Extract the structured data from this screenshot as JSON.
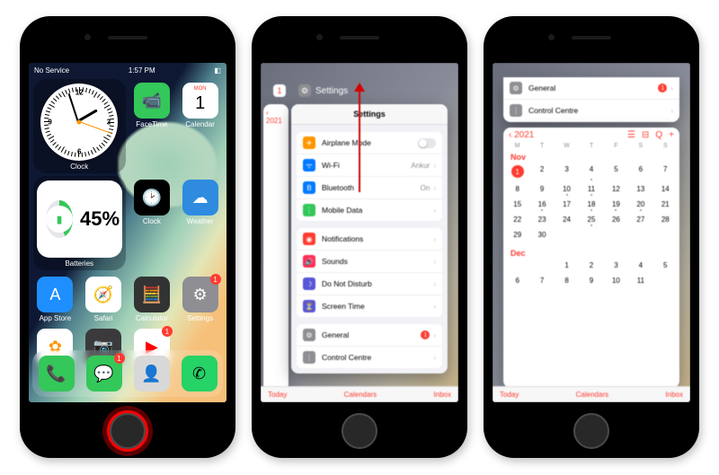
{
  "status": {
    "left": "No Service",
    "time": "1:57 PM",
    "battPct": "45"
  },
  "phone1": {
    "clockWidget": {
      "label": "Clock",
      "hourDeg": 60,
      "minDeg": 342,
      "secDeg": 110
    },
    "batteryWidget": {
      "label": "Batteries",
      "pct": "45%"
    },
    "row1": [
      {
        "name": "FaceTime",
        "bg": "#34c759",
        "glyph": "📹"
      },
      {
        "name": "Calendar",
        "bg": "#ffffff",
        "glyph": "1",
        "topText": "MON",
        "color": "#000"
      }
    ],
    "row2": [
      {
        "name": "Clock",
        "bg": "#000000",
        "glyph": "🕑"
      },
      {
        "name": "Weather",
        "bg": "#2e8bdf",
        "glyph": "☁"
      }
    ],
    "row3": [
      {
        "name": "App Store",
        "bg": "#1f8fff",
        "glyph": "A"
      },
      {
        "name": "Safari",
        "bg": "#ffffff",
        "glyph": "🧭"
      }
    ],
    "row4": [
      {
        "name": "Calculator",
        "bg": "#333333",
        "glyph": "🧮"
      },
      {
        "name": "Settings",
        "bg": "#8e8e93",
        "glyph": "⚙",
        "badge": "1"
      }
    ],
    "row5": [
      {
        "name": "Photos",
        "bg": "#ffffff",
        "glyph": "✿",
        "color": "#ff9500"
      },
      {
        "name": "Camera",
        "bg": "#3a3a3c",
        "glyph": "📷"
      },
      {
        "name": "YouTube",
        "bg": "#ffffff",
        "glyph": "▶",
        "color": "#ff0000",
        "badge": "1"
      }
    ],
    "dock": [
      {
        "name": "Phone",
        "bg": "#34c759",
        "glyph": "📞"
      },
      {
        "name": "Messages",
        "bg": "#34c759",
        "glyph": "💬",
        "badge": "1"
      },
      {
        "name": "Contacts",
        "bg": "#d8d8d8",
        "glyph": "👤"
      },
      {
        "name": "WhatsApp",
        "bg": "#25d366",
        "glyph": "✆"
      }
    ]
  },
  "phone2": {
    "cardTitle": "Settings",
    "backYear": "2021",
    "header": "Settings",
    "group1": [
      {
        "label": "Airplane Mode",
        "bg": "#ff9500",
        "glyph": "✈",
        "right": "toggle"
      },
      {
        "label": "Wi-Fi",
        "bg": "#007aff",
        "glyph": "ᯤ",
        "right": "Ankur"
      },
      {
        "label": "Bluetooth",
        "bg": "#007aff",
        "glyph": "B",
        "right": "On"
      },
      {
        "label": "Mobile Data",
        "bg": "#34c759",
        "glyph": "⋮",
        "right": ""
      }
    ],
    "group2": [
      {
        "label": "Notifications",
        "bg": "#ff3b30",
        "glyph": "◉"
      },
      {
        "label": "Sounds",
        "bg": "#ff2d55",
        "glyph": "🔊"
      },
      {
        "label": "Do Not Disturb",
        "bg": "#5856d6",
        "glyph": "☽"
      },
      {
        "label": "Screen Time",
        "bg": "#5856d6",
        "glyph": "⏳"
      }
    ],
    "group3": [
      {
        "label": "General",
        "bg": "#8e8e93",
        "glyph": "⚙",
        "badge": "1"
      },
      {
        "label": "Control Centre",
        "bg": "#8e8e93",
        "glyph": "⋮"
      }
    ],
    "bottom": {
      "left": "Today",
      "center": "Calendars",
      "right": "Inbox"
    }
  },
  "phone3": {
    "settCard": [
      {
        "label": "General",
        "bg": "#8e8e93",
        "glyph": "⚙",
        "badge": "1"
      },
      {
        "label": "Control Centre",
        "bg": "#8e8e93",
        "glyph": "⋮"
      }
    ],
    "calBack": "2021",
    "toolbar": [
      "☰",
      "⊟",
      "Q",
      "+"
    ],
    "week": [
      "M",
      "T",
      "W",
      "T",
      "F",
      "S",
      "S"
    ],
    "months": [
      {
        "name": "Nov",
        "start": 0,
        "days": 30,
        "today": 1,
        "dots": [
          4,
          10,
          11,
          16,
          18,
          19,
          20,
          25
        ]
      },
      {
        "name": "Dec",
        "start": 2,
        "days": 11,
        "dots": []
      }
    ],
    "bottom": {
      "left": "Today",
      "center": "Calendars",
      "right": "Inbox"
    }
  }
}
